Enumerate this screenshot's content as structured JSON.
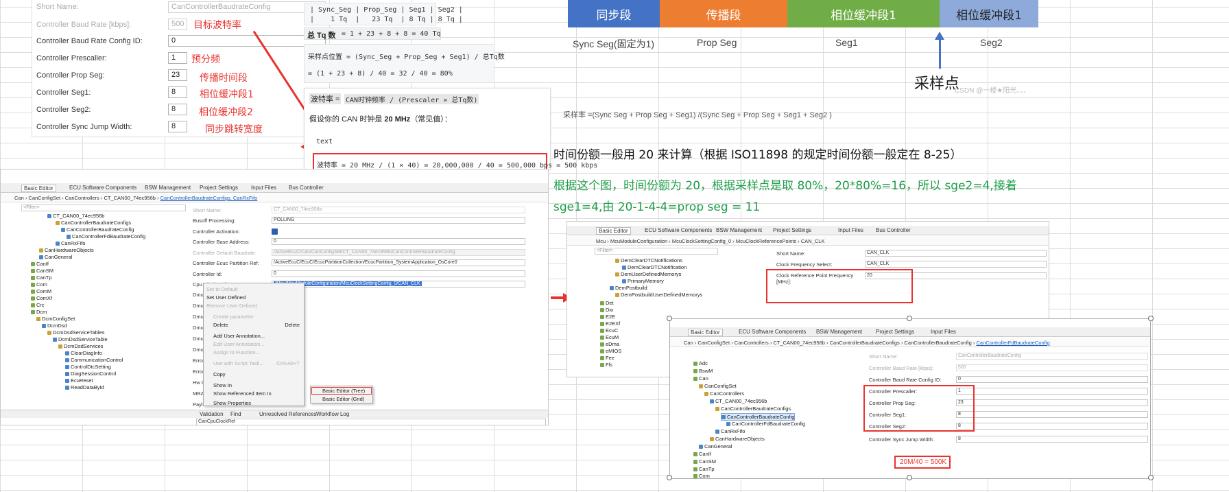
{
  "top_form": {
    "rows": [
      {
        "label": "Short Name:",
        "value": "CanControllerBaudrateConfig",
        "dim": true
      },
      {
        "label": "Controller Baud Rate [kbps]:",
        "value": "500",
        "dim": true
      },
      {
        "label": "Controller Baud Rate Config ID:",
        "value": "0",
        "dim": false
      },
      {
        "label": "Controller Prescaller:",
        "value": "1",
        "dim": false
      },
      {
        "label": "Controller Prop Seg:",
        "value": "23",
        "dim": false
      },
      {
        "label": "Controller Seg1:",
        "value": "8",
        "dim": false
      },
      {
        "label": "Controller Seg2:",
        "value": "8",
        "dim": false
      },
      {
        "label": "Controller Sync Jump Width:",
        "value": "8",
        "dim": false
      }
    ],
    "annotations": [
      "目标波特率",
      "预分频",
      "传播时间段",
      "相位缓冲段1",
      "相位缓冲段2",
      "同步跳转宽度"
    ]
  },
  "formula": {
    "table_header": "| Sync_Seg | Prop_Seg | Seg1 | Seg2 |",
    "table_row": "|    1 Tq  |   23 Tq  | 8 Tq | 8 Tq |",
    "total_label": "总 Tq 数",
    "total_expr": " = 1 + 23 + 8 + 8 = 40 Tq",
    "sample_expr": "采样点位置 = (Sync_Seg + Prop_Seg + Seg1) / 总Tq数",
    "sample_calc": "= (1 + 23 + 8) / 40 = 32 / 40 = 80%",
    "baud_label": "波特率 =",
    "baud_expr": "CAN时钟频率 / (Prescaler × 总Tq数)",
    "assume_prefix": "假设你的 CAN 时钟是 ",
    "assume_bold": "20 MHz",
    "assume_suffix": "（常见值）：",
    "text_tag": "text",
    "result": "波特率 = 20 MHz / (1 × 40) = 20,000,000 / 40 = 500,000 bps = 500 kbps"
  },
  "diagram": {
    "segments": [
      {
        "label": "同步段",
        "color": "#4472c4",
        "caption": "Sync Seg(固定为1)"
      },
      {
        "label": "传播段",
        "color": "#ed7d31",
        "caption": "Prop Seg"
      },
      {
        "label": "相位缓冲段1",
        "color": "#70ad47",
        "caption": "Seg1"
      },
      {
        "label": "相位缓冲段1",
        "color": "#8eaadb",
        "caption": "Seg2"
      }
    ],
    "sample_point_label": "采样点",
    "watermark": "CSDN @一楼★阳光、、、",
    "formula": "采样率 =(Sync Seg + Prop Seg + Seg1) /(Sync Seg + Prop Seg + Seg1 + Seg2 )"
  },
  "notes": {
    "line1": "时间份额一般用 20 来计算（根据 ISO11898 的规定时间份额一般定在 8-25）",
    "line2": "根据这个图，时间份额为 20，根据采样点是取 80%，20*80%=16，所以 sge2=4,接着",
    "line3": "sge1=4,由 20-1-4-4=prop seg = 11"
  },
  "ide_left": {
    "tabs": [
      "Basic Editor",
      "ECU Software Components",
      "BSW Management",
      "Project Settings",
      "Input Files",
      "Bus Controller"
    ],
    "crumb_plain": "Can  ›  CanConfigSet  ›  CanControllers  ›  CT_CAN00_74ec956b  ›  ",
    "crumb_link": "CanControllerBaudrateConfigs, CanRxFifo",
    "filter": "<Filter>",
    "tree": [
      "CT_CAN00_74ec956b",
      "CanControllerBaudrateConfigs",
      "CanControllerBaudrateConfig",
      "CanControllerFdBaudrateConfig",
      "CanRxFifo",
      "CanHardwareObjects",
      "CanGeneral",
      "CanIf",
      "CanSM",
      "CanTp",
      "Com",
      "ComM",
      "ComXf",
      "Crc",
      "Dcm",
      "DcmConfigSet",
      "DcmDsd",
      "DcmDsdServiceTables",
      "DcmDsdServiceTable",
      "DcmDsdServices",
      "ClearDiagInfo",
      "CommunicationControl",
      "ControlDtcSetting",
      "DiagSessionControl",
      "EcuReset",
      "ReadDataById"
    ],
    "fields": [
      {
        "label": "Short Name:",
        "value": "CT_CAN00_74ec956b",
        "dim": true
      },
      {
        "label": "Busoff Processing:",
        "value": "POLLING",
        "dim": false
      },
      {
        "label": "Controller Activation:",
        "value": "",
        "dim": false
      },
      {
        "label": "Controller Base Address:",
        "value": "0",
        "dim": false
      },
      {
        "label": "Controller Default Baudrate:",
        "value": "/ActiveEcuC/Can/CanConfigSet/CT_CAN00_74ec956b/CanControllerBaudrateConfig",
        "dim": true
      },
      {
        "label": "Controller Ecuc Partition Ref:",
        "value": "/ActiveEcuC/EcuC/EcucPartitionCollection/EcucPartition_SystemApplication_OsCore0",
        "dim": false
      },
      {
        "label": "Controller Id:",
        "value": "0",
        "dim": false
      },
      {
        "label": "Cpu Clock Ref:",
        "value": "/Mcu/McuModuleConfiguration/McuClockSettingConfig_0/CAN_CLK",
        "dim": false
      }
    ],
    "menu": [
      "Set to Default",
      "Set User Defined",
      "Remove User Defined",
      "Create parameter",
      "Delete",
      "Add User Annotation...",
      "Edit User Annotation...",
      "Assign to Function...",
      "Use with Script Task...",
      "Copy",
      "Show In",
      "Show Referenced Item In",
      "Show Properties"
    ],
    "menu_shortcuts": {
      "delete": "Delete",
      "script": "Ctrl+Alt+T"
    },
    "submenu": [
      "Basic Editor (Tree)",
      "Basic Editor (Grid)"
    ],
    "bottom_tabs": [
      "Validation",
      "Find",
      "Unresolved References",
      "Workflow Log"
    ],
    "bottom_value": "CanCpuClockRef",
    "side_labels": [
      "Dmu R",
      "Dmu R",
      "Dmu R",
      "Dmu R",
      "Dmu T",
      "Dmu T",
      "Error C",
      "Error C",
      "Hw Ch",
      "MRAF",
      "Payloa"
    ]
  },
  "ide_mid": {
    "tabs": [
      "Basic Editor",
      "ECU Software Components",
      "BSW Management",
      "Project Settings",
      "Input Files",
      "Bus Controller"
    ],
    "crumb": "Mcu  ›  McuModuleConfiguration  ›  McuClockSettingConfig_0  ›  McuClockReferencePoints  ›  CAN_CLK",
    "filter": "<Filter>",
    "tree": [
      "DemClearDTCNotifications",
      "DemClearDTCNotification",
      "DemUserDefinedMemorys",
      "PrimaryMemory",
      "DemPostbuild",
      "DemPostbuildUserDefinedMemorys",
      "Det",
      "Dio",
      "E2E",
      "E2EXf",
      "EcuC",
      "EcuM",
      "eDma",
      "eMIOS",
      "Fee",
      "Fls"
    ],
    "fields": [
      {
        "label": "Short Name:",
        "value": "CAN_CLK"
      },
      {
        "label": "Clock Frequency Select:",
        "value": "CAN_CLK"
      },
      {
        "label": "Clock Reference Point Frequency [MHz]:",
        "value": "20"
      }
    ]
  },
  "ide_right": {
    "tabs": [
      "Basic Editor",
      "ECU Software Components",
      "BSW Management",
      "Project Settings",
      "Input Files"
    ],
    "crumb_plain": "Can  ›  CanConfigSet  ›  CanControllers  ›  CT_CAN00_74ec956b  ›  CanControllerBaudrateConfigs  ›  CanControllerBaudrateConfig  ›  ",
    "crumb_link": "CanControllerFdBaudrateConfig",
    "tree": [
      "Adc",
      "BswM",
      "Can",
      "CanConfigSet",
      "CanControllers",
      "CT_CAN00_74ec956b",
      "CanControllerBaudrateConfigs",
      "CanControllerBaudrateConfig",
      "CanControllerFdBaudrateConfig",
      "CanRxFifo",
      "CanHardwareObjects",
      "CanGeneral",
      "CanIf",
      "CanSM",
      "CanTp",
      "Com"
    ],
    "fields": [
      {
        "label": "Short Name:",
        "value": "CanControllerBaudrateConfig",
        "dim": true
      },
      {
        "label": "Controller Baud Rate [kbps]:",
        "value": "500",
        "dim": true
      },
      {
        "label": "Controller Baud Rate Config ID:",
        "value": "0",
        "dim": false
      },
      {
        "label": "Controller Prescaller:",
        "value": "1",
        "dim": false
      },
      {
        "label": "Controller Prop Seg:",
        "value": "23",
        "dim": false
      },
      {
        "label": "Controller Seg1:",
        "value": "8",
        "dim": false
      },
      {
        "label": "Controller Seg2:",
        "value": "8",
        "dim": false
      },
      {
        "label": "Controller Sync Jump Width:",
        "value": "8",
        "dim": false
      }
    ],
    "result_box": "20M/40 = 500K"
  }
}
